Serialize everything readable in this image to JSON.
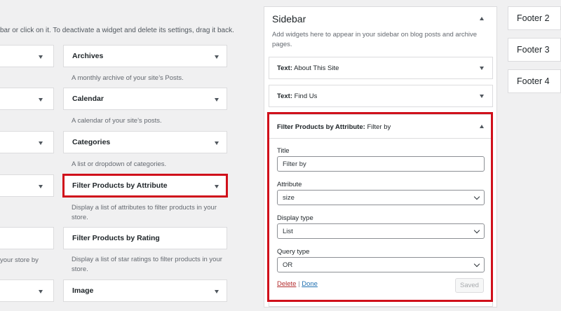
{
  "intro_text": "bar or click on it. To deactivate a widget and delete its settings, drag it back.",
  "available_widgets": [
    {
      "name": "Archives",
      "desc": "A monthly archive of your site’s Posts."
    },
    {
      "name": "Calendar",
      "desc": "A calendar of your site’s posts."
    },
    {
      "name": "Categories",
      "desc": "A list or dropdown of categories."
    },
    {
      "name": "Filter Products by Attribute",
      "desc": "Display a list of attributes to filter products in your store."
    },
    {
      "name": "Filter Products by Rating",
      "desc": "Display a list of star ratings to filter products in your store."
    },
    {
      "name": "Image",
      "desc": ""
    }
  ],
  "left_partial_desc": "your store by",
  "sidebar": {
    "title": "Sidebar",
    "description": "Add widgets here to appear in your sidebar on blog posts and archive pages.",
    "widgets": [
      {
        "type": "Text:",
        "title": "About This Site"
      },
      {
        "type": "Text:",
        "title": "Find Us"
      }
    ],
    "open_widget": {
      "type": "Filter Products by Attribute:",
      "title": "Filter by",
      "fields": {
        "title_label": "Title",
        "title_value": "Filter by",
        "attribute_label": "Attribute",
        "attribute_value": "size",
        "display_type_label": "Display type",
        "display_type_value": "List",
        "query_type_label": "Query type",
        "query_type_value": "OR"
      },
      "delete_label": "Delete",
      "separator": "|",
      "done_label": "Done",
      "saved_label": "Saved"
    }
  },
  "footers": [
    "Footer 2",
    "Footer 3",
    "Footer 4"
  ],
  "colors": {
    "highlight": "#d0101b",
    "link": "#2271b1",
    "delete": "#b32d2e"
  }
}
